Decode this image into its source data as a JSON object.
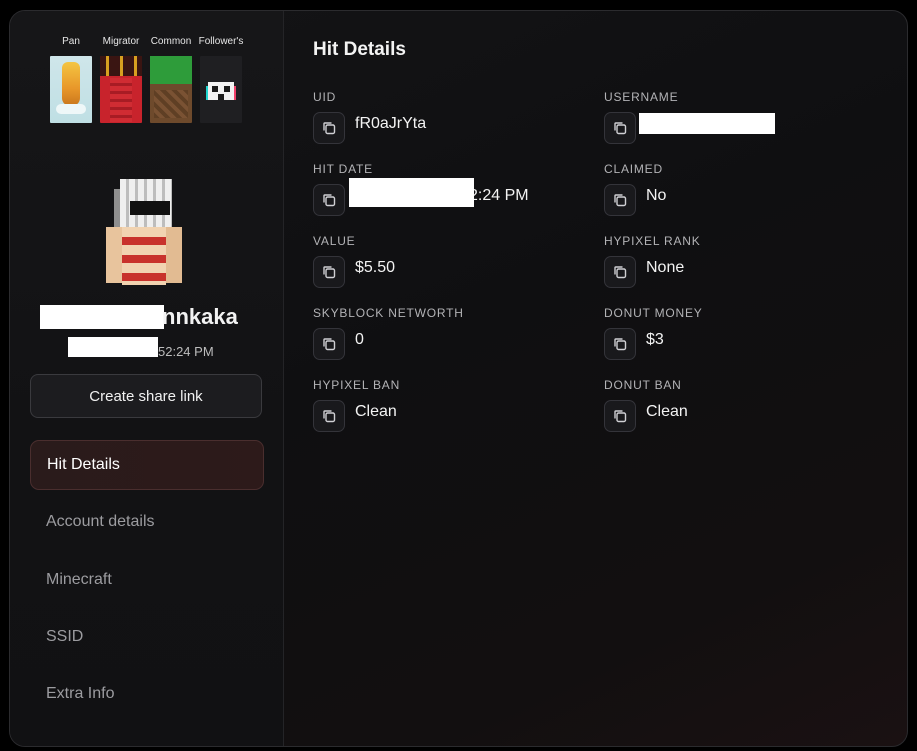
{
  "capes": [
    {
      "label": "Pan",
      "icon": "pan-cape-icon"
    },
    {
      "label": "Migrator",
      "icon": "migrator-cape-icon"
    },
    {
      "label": "Common",
      "icon": "common-cape-icon"
    },
    {
      "label": "Follower's",
      "icon": "followers-cape-icon"
    }
  ],
  "profile": {
    "name_visible": "nnkaka",
    "time_visible": "52:24 PM"
  },
  "share_button": {
    "label": "Create share link"
  },
  "nav": [
    {
      "label": "Hit Details",
      "active": true
    },
    {
      "label": "Account details",
      "active": false
    },
    {
      "label": "Minecraft",
      "active": false
    },
    {
      "label": "SSID",
      "active": false
    },
    {
      "label": "Extra Info",
      "active": false
    }
  ],
  "main": {
    "title": "Hit Details",
    "fields": [
      {
        "key": "uid",
        "label": "UID",
        "value": "fR0aJrYta"
      },
      {
        "key": "username",
        "label": "USERNAME",
        "value": ""
      },
      {
        "key": "hit_date",
        "label": "HIT DATE",
        "value": "2:24 PM"
      },
      {
        "key": "claimed",
        "label": "CLAIMED",
        "value": "No"
      },
      {
        "key": "value",
        "label": "VALUE",
        "value": "$5.50"
      },
      {
        "key": "hypixel_rank",
        "label": "HYPIXEL RANK",
        "value": "None"
      },
      {
        "key": "skyblock_networth",
        "label": "SKYBLOCK NETWORTH",
        "value": "0"
      },
      {
        "key": "donut_money",
        "label": "DONUT MONEY",
        "value": "$3"
      },
      {
        "key": "hypixel_ban",
        "label": "HYPIXEL BAN",
        "value": "Clean"
      },
      {
        "key": "donut_ban",
        "label": "DONUT BAN",
        "value": "Clean"
      }
    ]
  },
  "colors": {
    "background": "#0f0f11",
    "sidebar": "#141416",
    "active_nav": "#2a1b1b",
    "text": "#f3f3f3",
    "muted": "#9c9ca0"
  }
}
